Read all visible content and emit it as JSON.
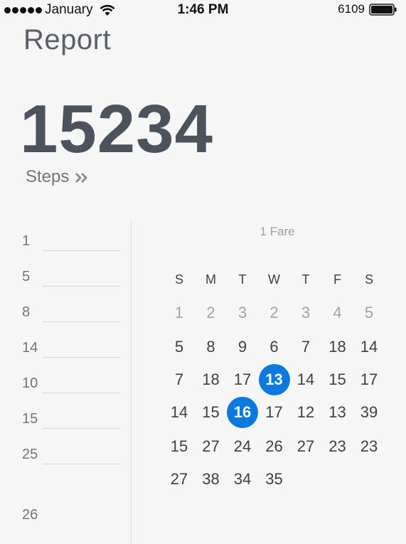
{
  "status_bar": {
    "carrier": "January",
    "time": "1:46 PM",
    "battery": "6109"
  },
  "header": {
    "title": "Report"
  },
  "steps": {
    "count": "15234",
    "label": "Steps"
  },
  "list": {
    "items": [
      "1",
      "5",
      "8",
      "14",
      "10",
      "15",
      "25"
    ],
    "last": "26"
  },
  "calendar": {
    "header": "1 Fare",
    "weekdays": [
      "S",
      "M",
      "T",
      "W",
      "T",
      "F",
      "S"
    ],
    "rows": [
      [
        "1",
        "2",
        "3",
        "2",
        "3",
        "4",
        "5"
      ],
      [
        "5",
        "8",
        "9",
        "6",
        "7",
        "18",
        "14"
      ],
      [
        "7",
        "18",
        "17",
        "13",
        "14",
        "15",
        "17"
      ],
      [
        "14",
        "15",
        "16",
        "17",
        "12",
        "13",
        "39"
      ],
      [
        "15",
        "27",
        "24",
        "26",
        "27",
        "23",
        "23"
      ],
      [
        "27",
        "38",
        "34",
        "35"
      ]
    ],
    "muted_row": 0,
    "selected": [
      {
        "row": 2,
        "col": 3
      },
      {
        "row": 3,
        "col": 2
      }
    ],
    "selected_color": "#0a79e0"
  }
}
